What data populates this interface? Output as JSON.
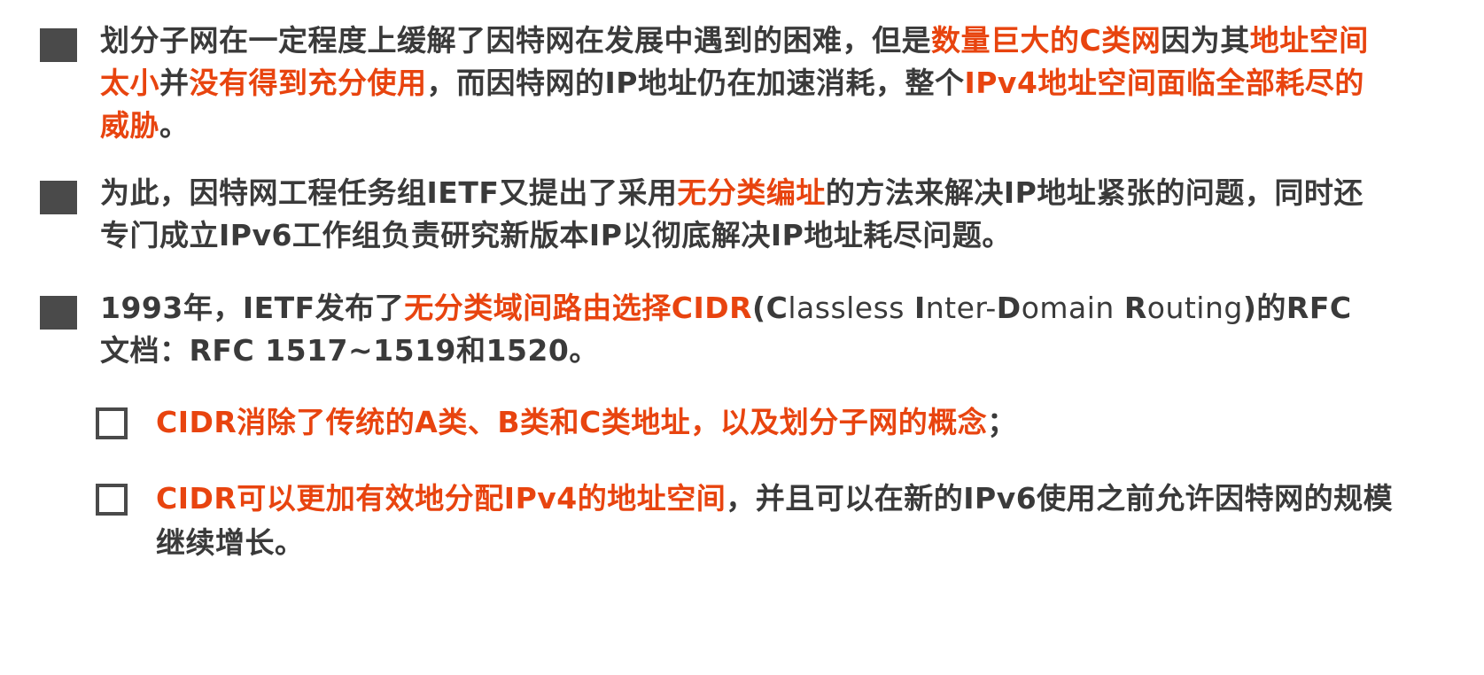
{
  "colors": {
    "highlight": "#e8440f",
    "text": "#3a3a3a",
    "marker": "#4a4a4a"
  },
  "bullets": [
    {
      "segments": [
        {
          "t": "划分子网在一定程度上缓解了因特网在发展中遇到的困难，但是",
          "hl": false
        },
        {
          "t": "数量巨大的C类网",
          "hl": true
        },
        {
          "t": "因为其",
          "hl": false
        },
        {
          "t": "地址空间太小",
          "hl": true
        },
        {
          "t": "并",
          "hl": false
        },
        {
          "t": "没有得到充分使用",
          "hl": true
        },
        {
          "t": "，而因特网的IP地址仍在加速消耗，整个",
          "hl": false
        },
        {
          "t": "IPv4地址空间面临全部耗尽的威胁",
          "hl": true
        },
        {
          "t": "。",
          "hl": false
        }
      ]
    },
    {
      "segments": [
        {
          "t": "为此，因特网工程任务组IETF又提出了采用",
          "hl": false
        },
        {
          "t": "无分类编址",
          "hl": true
        },
        {
          "t": "的方法来解决IP地址紧张的问题，同时还专门成立IPv6工作组负责研究新版本IP以彻底解决IP地址耗尽问题。",
          "hl": false
        }
      ]
    },
    {
      "segments": [
        {
          "t": "1993年，IETF发布了",
          "hl": false
        },
        {
          "t": "无分类域间路由选择CIDR",
          "hl": true
        },
        {
          "t": "(C",
          "hl": false
        },
        {
          "t": "lassless ",
          "hl": false,
          "light": true
        },
        {
          "t": "I",
          "hl": false
        },
        {
          "t": "nter-",
          "hl": false,
          "light": true
        },
        {
          "t": "D",
          "hl": false
        },
        {
          "t": "omain ",
          "hl": false,
          "light": true
        },
        {
          "t": "R",
          "hl": false
        },
        {
          "t": "outing",
          "hl": false,
          "light": true
        },
        {
          "t": ")的RFC文档：RFC 1517~1519和1520。",
          "hl": false
        }
      ]
    }
  ],
  "sub_bullets": [
    {
      "segments": [
        {
          "t": "CIDR消除了传统的A类、B类和C类地址，以及划分子网的概念",
          "hl": true
        },
        {
          "t": "；",
          "hl": false
        }
      ]
    },
    {
      "segments": [
        {
          "t": "CIDR可以更加有效地分配IPv4的地址空间",
          "hl": true
        },
        {
          "t": "，并且可以在新的IPv6使用之前允许因特网的规模继续增长。",
          "hl": false
        }
      ]
    }
  ]
}
